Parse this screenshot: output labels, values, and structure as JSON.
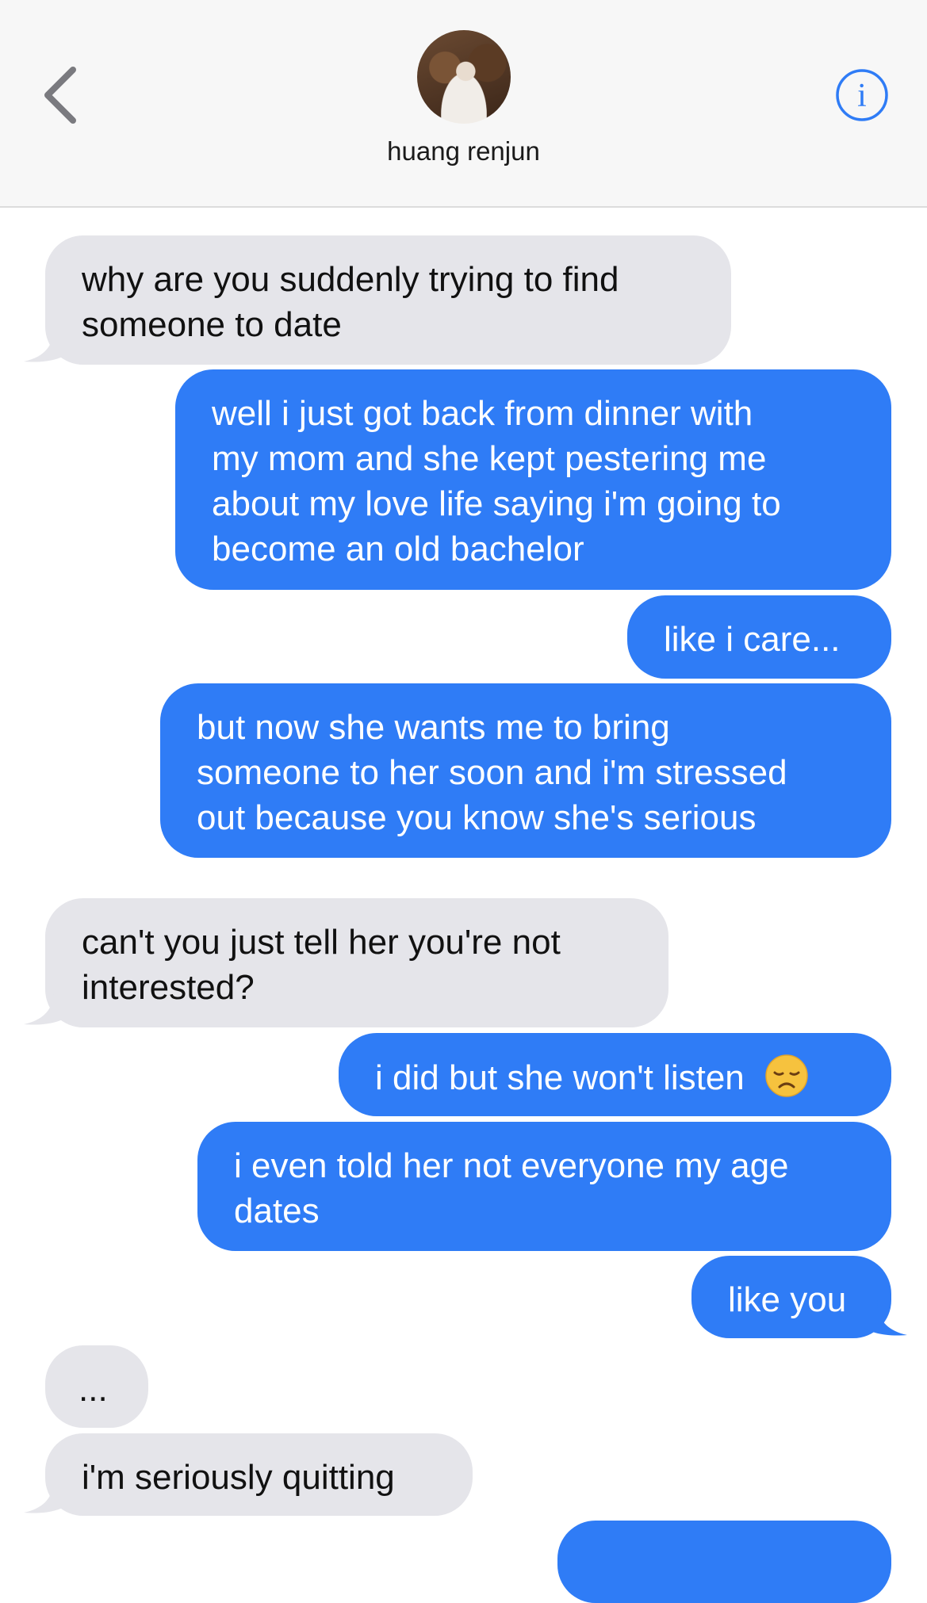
{
  "header": {
    "contact_name": "huang renjun",
    "back_icon": "chevron-left-icon",
    "info_icon": "info-icon",
    "info_glyph": "i",
    "accent_color": "#2f7cf6"
  },
  "messages": [
    {
      "sender": "contact",
      "lines": [
        "why are you suddenly trying to find",
        "someone to date"
      ]
    },
    {
      "sender": "me",
      "lines": [
        "well i just got back from dinner with",
        "my mom and she kept pestering me",
        "about my love life saying i'm going to",
        "become an old bachelor"
      ]
    },
    {
      "sender": "me",
      "lines": [
        "like i care..."
      ]
    },
    {
      "sender": "me",
      "lines": [
        "but now she wants me to bring",
        "someone to her soon and i'm stressed",
        "out because you know she's serious"
      ]
    },
    {
      "sender": "contact",
      "lines": [
        "can't you just tell her you're not",
        "interested?"
      ]
    },
    {
      "sender": "me",
      "lines": [
        "i did but she won't listen"
      ],
      "emoji": "disappointed-face"
    },
    {
      "sender": "me",
      "lines": [
        "i even told her not everyone my age",
        "dates"
      ]
    },
    {
      "sender": "me",
      "lines": [
        "like you"
      ]
    },
    {
      "sender": "contact",
      "lines": [
        "..."
      ]
    },
    {
      "sender": "contact",
      "lines": [
        "i'm seriously quitting"
      ]
    }
  ],
  "colors": {
    "incoming_bubble": "#e5e5ea",
    "outgoing_bubble": "#2f7cf6",
    "outgoing_text": "#ffffff",
    "incoming_text": "#111111"
  }
}
